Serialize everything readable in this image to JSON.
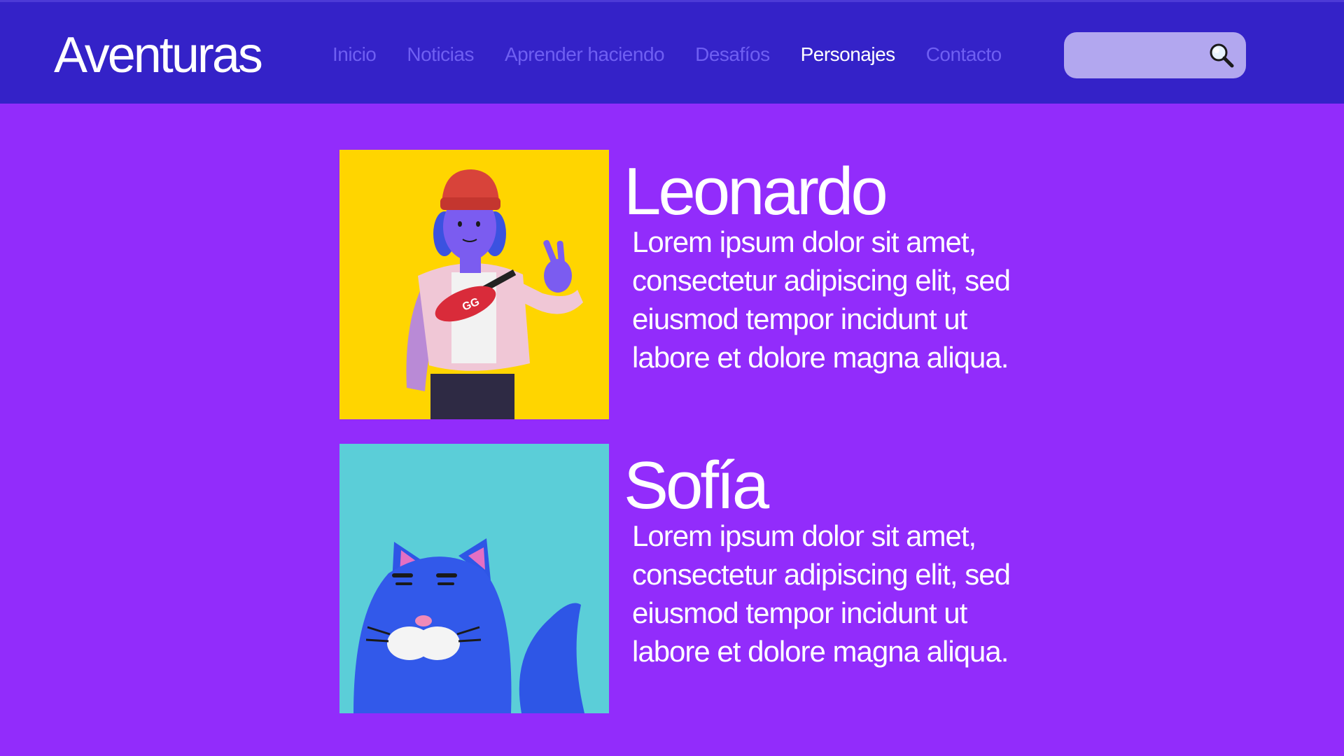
{
  "header": {
    "logo": "Aventuras",
    "nav": [
      {
        "label": "Inicio",
        "active": false
      },
      {
        "label": "Noticias",
        "active": false
      },
      {
        "label": "Aprender haciendo",
        "active": false
      },
      {
        "label": "Desafíos",
        "active": false
      },
      {
        "label": "Personajes",
        "active": true
      },
      {
        "label": "Contacto",
        "active": false
      }
    ],
    "search": {
      "value": "",
      "placeholder": "",
      "icon": "search-icon"
    }
  },
  "characters": [
    {
      "name": "Leonardo",
      "description": "Lorem ipsum dolor sit amet, consectetur adipiscing elit, sed eiusmod tempor incidunt ut labore et dolore magna aliqua.",
      "image_background": "#ffd500"
    },
    {
      "name": "Sofía",
      "description": "Lorem ipsum dolor sit amet, consectetur adipiscing elit, sed eiusmod tempor incidunt ut labore et dolore magna aliqua.",
      "image_background": "#5bced8"
    }
  ],
  "colors": {
    "page_background": "#922cfb",
    "header_background": "#3422c8",
    "nav_inactive": "#6f5ff2",
    "nav_active": "#ffffff",
    "search_background": "#b2a7ef"
  }
}
